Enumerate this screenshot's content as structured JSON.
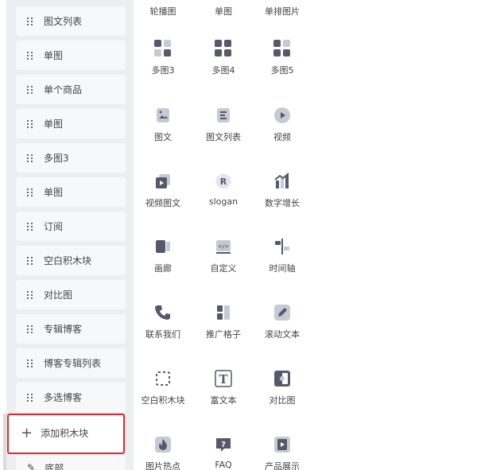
{
  "blocks": [
    {
      "label": "图文列表"
    },
    {
      "label": "单图"
    },
    {
      "label": "单个商品"
    },
    {
      "label": "单图"
    },
    {
      "label": "多图3"
    },
    {
      "label": "单图"
    },
    {
      "label": "订阅"
    },
    {
      "label": "空白积木块"
    },
    {
      "label": "对比图"
    },
    {
      "label": "专辑博客"
    },
    {
      "label": "博客专辑列表"
    },
    {
      "label": "多选博客"
    }
  ],
  "add_block": {
    "label": "添加积木块",
    "icon": "plus-icon"
  },
  "footer": {
    "label": "底部",
    "icon": "pin-icon"
  },
  "components": {
    "top_row": [
      "轮播图",
      "单图",
      "单排图片"
    ],
    "rows": [
      [
        {
          "label": "多图3",
          "icon": "grid-icon"
        },
        {
          "label": "多图4",
          "icon": "grid-icon"
        },
        {
          "label": "多图5",
          "icon": "grid-icon"
        }
      ],
      [
        {
          "label": "图文",
          "icon": "image-text-icon"
        },
        {
          "label": "图文列表",
          "icon": "list-icon"
        },
        {
          "label": "视频",
          "icon": "play-icon"
        }
      ],
      [
        {
          "label": "视频图文",
          "icon": "video-text-icon"
        },
        {
          "label": "slogan",
          "icon": "slogan-icon"
        },
        {
          "label": "数字增长",
          "icon": "growth-icon"
        }
      ],
      [
        {
          "label": "画廊",
          "icon": "gallery-icon"
        },
        {
          "label": "自定义",
          "icon": "code-icon"
        },
        {
          "label": "时间轴",
          "icon": "timeline-icon"
        }
      ],
      [
        {
          "label": "联系我们",
          "icon": "phone-icon"
        },
        {
          "label": "推广格子",
          "icon": "promo-grid-icon"
        },
        {
          "label": "滚动文本",
          "icon": "pencil-icon"
        }
      ],
      [
        {
          "label": "空白积木块",
          "icon": "dashed-box-icon"
        },
        {
          "label": "富文本",
          "icon": "rich-text-icon"
        },
        {
          "label": "对比图",
          "icon": "compare-icon"
        }
      ],
      [
        {
          "label": "图片热点",
          "icon": "flame-icon"
        },
        {
          "label": "FAQ",
          "icon": "faq-icon"
        },
        {
          "label": "产品展示",
          "icon": "showcase-icon"
        }
      ]
    ]
  },
  "icon_glyphs": {
    "rich_text": "T",
    "slogan": "R",
    "faq": "?",
    "code": "</>"
  },
  "colors": {
    "highlight": "#e5262d",
    "icon": "#55596a",
    "panel_bg": "#eceef2"
  }
}
